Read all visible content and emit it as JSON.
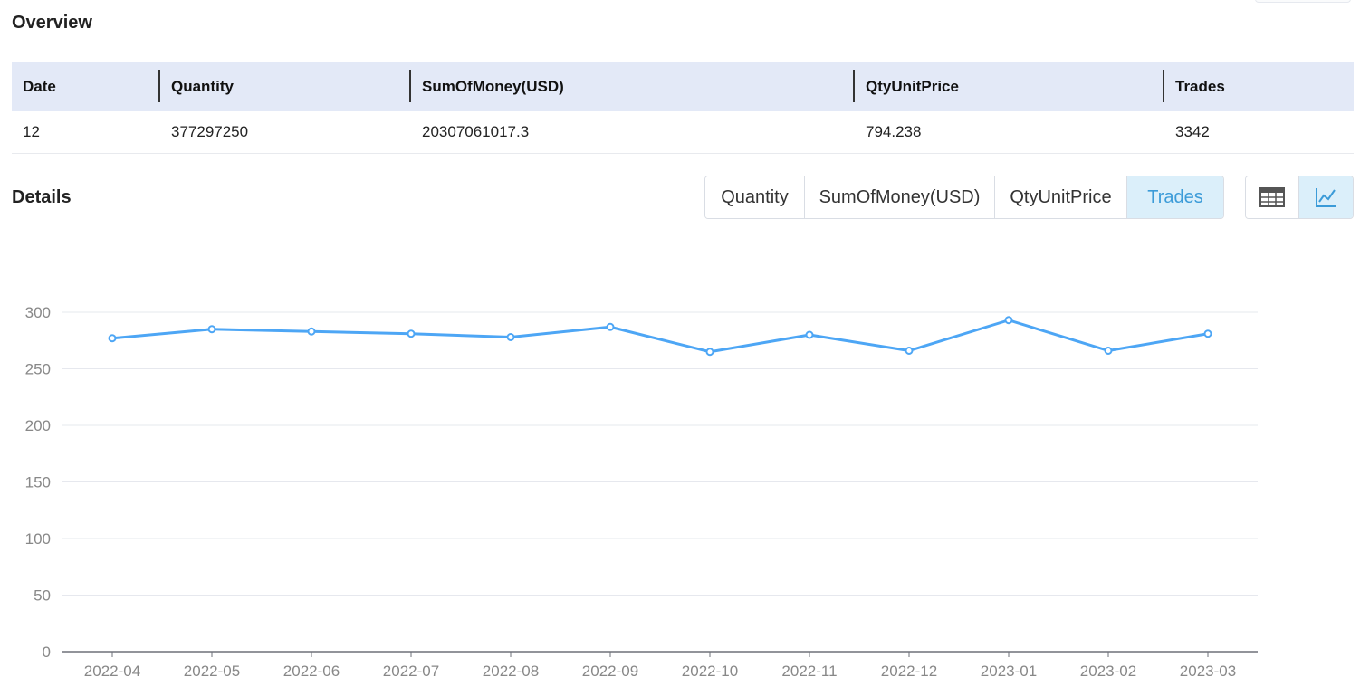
{
  "overview": {
    "title": "Overview",
    "headers": [
      "Date",
      "Quantity",
      "SumOfMoney(USD)",
      "QtyUnitPrice",
      "Trades"
    ],
    "row": [
      "12",
      "377297250",
      "20307061017.3",
      "794.238",
      "3342"
    ]
  },
  "details": {
    "title": "Details",
    "metric_tabs": [
      "Quantity",
      "SumOfMoney(USD)",
      "QtyUnitPrice",
      "Trades"
    ],
    "active_metric": "Trades",
    "view_modes": [
      "table-icon",
      "line-chart-icon"
    ],
    "active_view": "line-chart-icon"
  },
  "colors": {
    "accent": "#3b9bd8",
    "line": "#4da6f5",
    "header_bg": "#e3e9f7",
    "active_bg": "#dbeffa"
  },
  "chart_data": {
    "type": "line",
    "categories": [
      "2022-04",
      "2022-05",
      "2022-06",
      "2022-07",
      "2022-08",
      "2022-09",
      "2022-10",
      "2022-11",
      "2022-12",
      "2023-01",
      "2023-02",
      "2023-03"
    ],
    "series": [
      {
        "values": [
          277,
          285,
          283,
          281,
          278,
          287,
          265,
          280,
          266,
          293,
          266,
          281
        ]
      }
    ],
    "yticks": [
      0,
      50,
      100,
      150,
      200,
      250,
      300
    ],
    "ylim": [
      0,
      300
    ],
    "grid": true,
    "legend": "none"
  }
}
